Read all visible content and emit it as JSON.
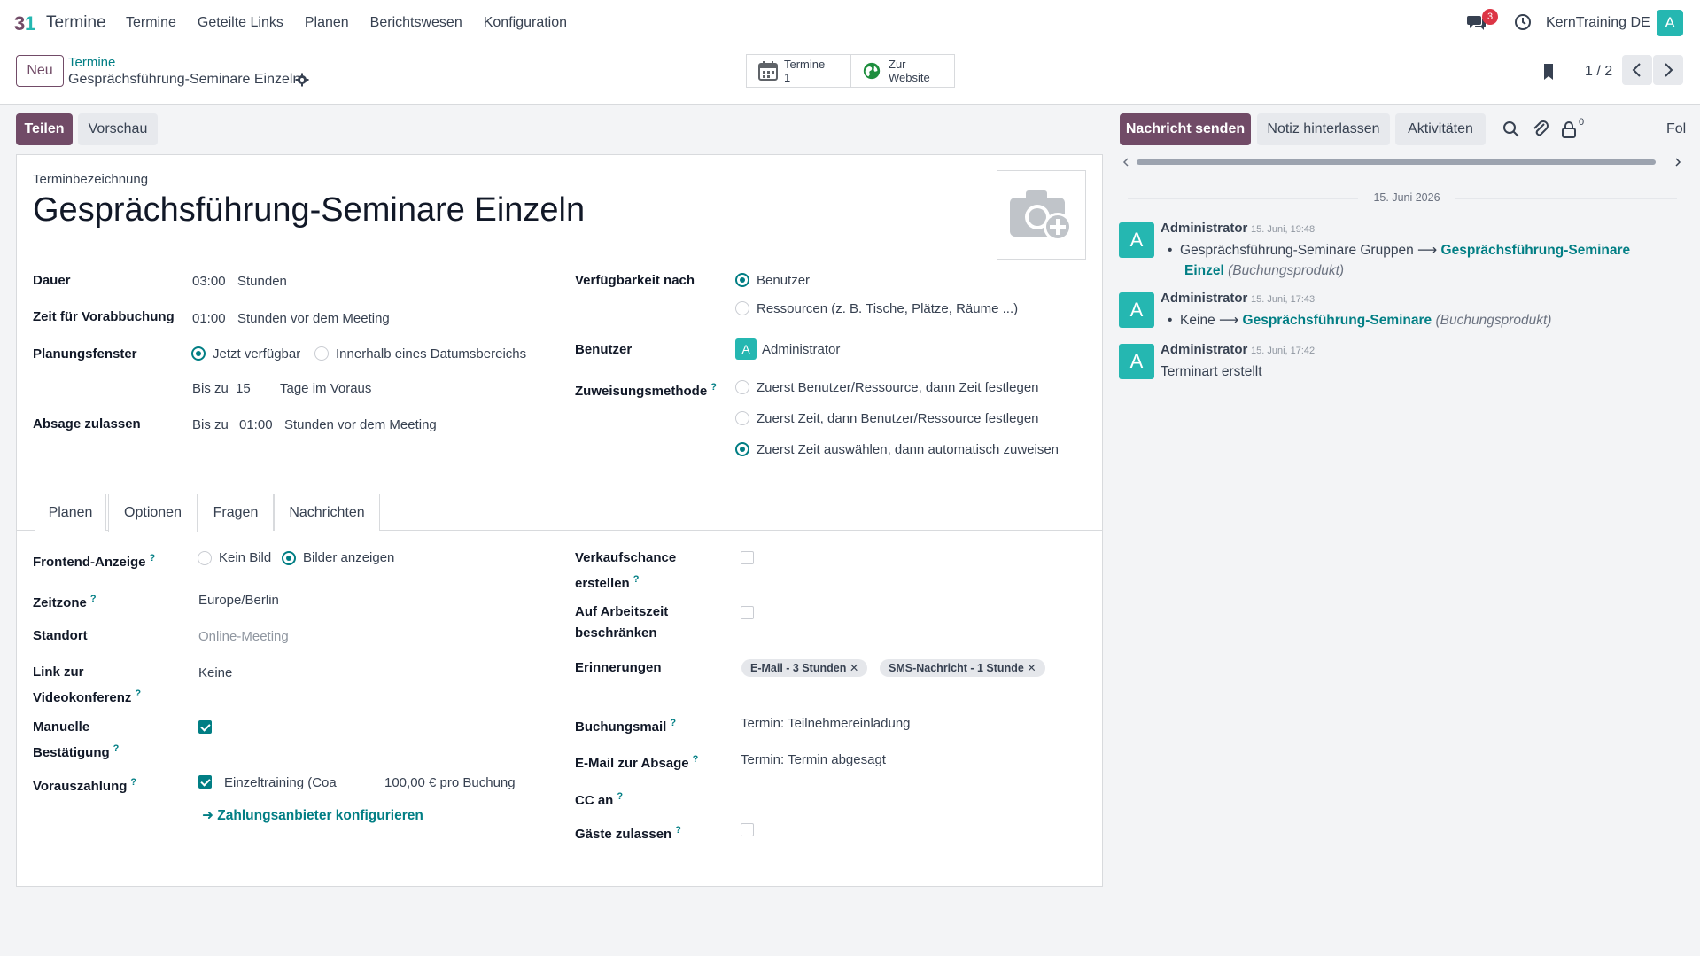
{
  "nav": {
    "app_name": "Termine",
    "menu": [
      "Termine",
      "Geteilte Links",
      "Planen",
      "Berichtswesen",
      "Konfiguration"
    ],
    "notification_count": "3",
    "company": "KernTraining DE",
    "user_initial": "A"
  },
  "control": {
    "new_label": "Neu",
    "breadcrumb_parent": "Termine",
    "breadcrumb_current": "Gesprächsführung-Seminare Einzeln",
    "smart_termine_label": "Termine",
    "smart_termine_count": "1",
    "smart_website_line1": "Zur",
    "smart_website_line2": "Website",
    "pager": "1 / 2"
  },
  "actions": {
    "share": "Teilen",
    "preview": "Vorschau"
  },
  "form": {
    "name_label": "Terminbezeichnung",
    "name": "Gesprächsführung-Seminare Einzeln",
    "duration_label": "Dauer",
    "duration_value": "03:00",
    "duration_unit": "Stunden",
    "prebook_label": "Zeit für Vorabbuchung",
    "prebook_value": "01:00",
    "prebook_unit": "Stunden vor dem Meeting",
    "window_label": "Planungsfenster",
    "window_opt1": "Jetzt verfügbar",
    "window_opt2": "Innerhalb eines Datumsbereichs",
    "window_upto": "Bis zu",
    "window_days": "15",
    "window_days_unit": "Tage im Voraus",
    "cancel_label": "Absage zulassen",
    "cancel_upto": "Bis zu",
    "cancel_value": "01:00",
    "cancel_unit": "Stunden vor dem Meeting",
    "availability_label": "Verfügbarkeit nach",
    "availability_opt1": "Benutzer",
    "availability_opt2": "Ressourcen (z. B. Tische, Plätze, Räume ...)",
    "users_label": "Benutzer",
    "users_initial": "A",
    "users_value": "Administrator",
    "assign_label": "Zuweisungsmethode",
    "assign_opt1": "Zuerst Benutzer/Ressource, dann Zeit festlegen",
    "assign_opt2": "Zuerst Zeit, dann Benutzer/Ressource festlegen",
    "assign_opt3": "Zuerst Zeit auswählen, dann automatisch zuweisen"
  },
  "tabs": [
    "Planen",
    "Optionen",
    "Fragen",
    "Nachrichten"
  ],
  "options": {
    "frontend_label": "Frontend-Anzeige",
    "frontend_opt1": "Kein Bild",
    "frontend_opt2": "Bilder anzeigen",
    "tz_label": "Zeitzone",
    "tz_value": "Europe/Berlin",
    "location_label": "Standort",
    "location_placeholder": "Online-Meeting",
    "video_label_1": "Link zur",
    "video_label_2": "Videokonferenz",
    "video_value": "Keine",
    "manual_label_1": "Manuelle",
    "manual_label_2": "Bestätigung",
    "prepay_label": "Vorauszahlung",
    "prepay_product": "Einzeltraining (Coa",
    "prepay_price": "100,00 € pro Buchung",
    "payment_link": "Zahlungsanbieter konfigurieren",
    "opportunity_label_1": "Verkaufschance",
    "opportunity_label_2": "erstellen",
    "worktime_label_1": "Auf Arbeitszeit",
    "worktime_label_2": "beschränken",
    "reminders_label": "Erinnerungen",
    "reminders": [
      "E-Mail - 3 Stunden",
      "SMS-Nachricht - 1 Stunde"
    ],
    "booking_mail_label": "Buchungsmail",
    "booking_mail_value": "Termin: Teilnehmereinladung",
    "cancel_mail_label": "E-Mail zur Absage",
    "cancel_mail_value": "Termin: Termin abgesagt",
    "cc_label": "CC an",
    "guests_label": "Gäste zulassen"
  },
  "chatter": {
    "send": "Nachricht senden",
    "note": "Notiz hinterlassen",
    "activities": "Aktivitäten",
    "followers_count": "0",
    "follow_truncated": "Fol",
    "date": "15. Juni 2026",
    "messages": [
      {
        "author": "Administrator",
        "time": "15. Juni, 19:48",
        "old": "Gesprächsführung-Seminare Gruppen",
        "new_1": "Gesprächsführung-Seminare",
        "new_2": "Einzel",
        "field": "(Buchungsprodukt)"
      },
      {
        "author": "Administrator",
        "time": "15. Juni, 17:43",
        "old": "Keine",
        "new_1": "Gesprächsführung-Seminare",
        "field": "(Buchungsprodukt)"
      },
      {
        "author": "Administrator",
        "time": "15. Juni, 17:42",
        "body": "Terminart erstellt"
      }
    ],
    "avatar_initial": "A"
  },
  "colors": {
    "primary": "#714b67",
    "teal": "#017e84",
    "avatar": "#25b7b1"
  }
}
